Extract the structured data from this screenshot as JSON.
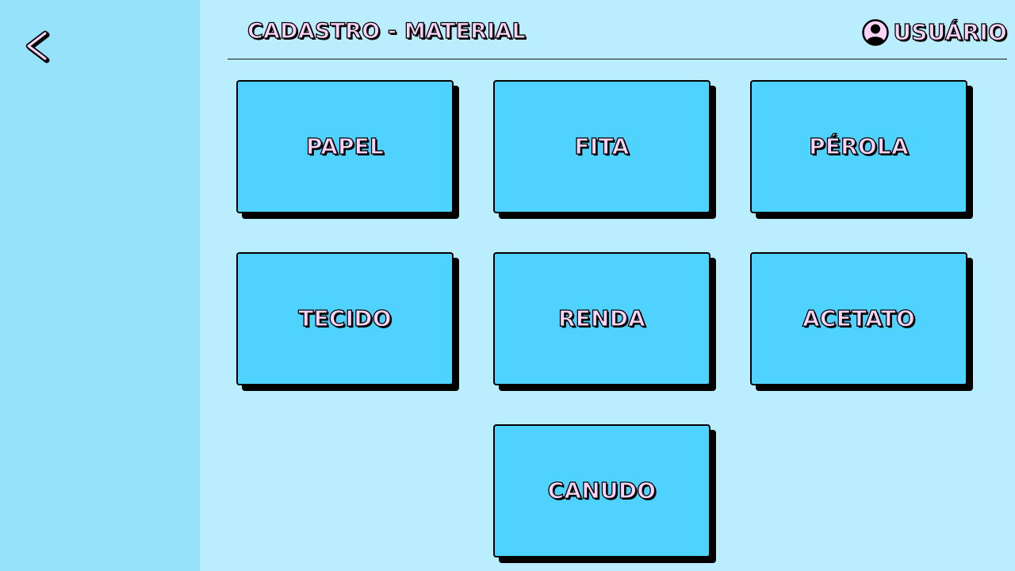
{
  "header": {
    "title": "CADASTRO - MATERIAL",
    "user_label": "USUÁRIO"
  },
  "icons": {
    "back": "chevron-left-icon",
    "user": "user-circle-icon"
  },
  "colors": {
    "background": "#baeefe",
    "sidebar": "#96e2fb",
    "card": "#4fd3fe",
    "text_fill": "#fbd3f6",
    "outline": "#000000"
  },
  "materials": [
    {
      "label": "PAPEL"
    },
    {
      "label": "FITA"
    },
    {
      "label": "PÉROLA"
    },
    {
      "label": "TECIDO"
    },
    {
      "label": "RENDA"
    },
    {
      "label": "ACETATO"
    },
    {
      "label": "CANUDO"
    }
  ]
}
